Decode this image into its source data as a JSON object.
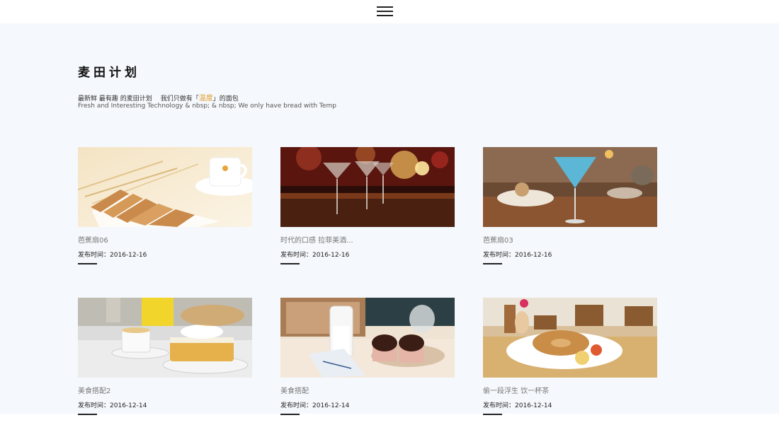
{
  "header": {
    "menu_icon": "hamburger-menu-icon"
  },
  "section": {
    "title": "麦田计划",
    "intro_prefix": "最新鲜 最有趣 的麦田计划",
    "intro_mid": "我们只做有「",
    "intro_highlight": "温度",
    "intro_suffix": "」的面包",
    "intro_en": "Fresh and Interesting Technology & nbsp; & nbsp; We only have bread with Temp",
    "highlight_color": "#e39a2d"
  },
  "cards": [
    {
      "title": "芭蕉扇06",
      "date_label": "发布时间：",
      "date": "2016-12-16",
      "image": "toast-and-coffee-cup"
    },
    {
      "title": "时代的口感 拉菲美酒...",
      "date_label": "发布时间：",
      "date": "2016-12-16",
      "image": "martini-glasses-at-bar"
    },
    {
      "title": "芭蕉扇03",
      "date_label": "发布时间：",
      "date": "2016-12-16",
      "image": "blue-cocktail-on-table"
    },
    {
      "title": "美食搭配2",
      "date_label": "发布时间：",
      "date": "2016-12-14",
      "image": "tea-cup-and-cake"
    },
    {
      "title": "美食搭配",
      "date_label": "发布时间：",
      "date": "2016-12-14",
      "image": "milk-bottle-and-cupcakes"
    },
    {
      "title": "偷一段浮生 饮一杯茶",
      "date_label": "发布时间：",
      "date": "2016-12-14",
      "image": "pastry-plate-in-cafe"
    }
  ]
}
